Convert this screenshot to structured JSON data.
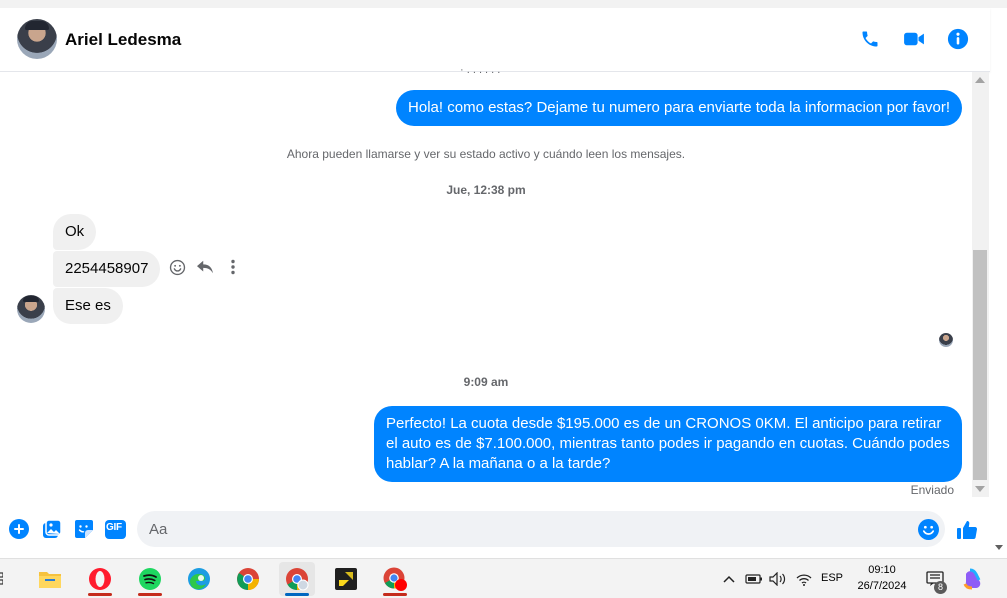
{
  "header": {
    "contact_name": "Ariel Ledesma",
    "icons": [
      "phone-icon",
      "video-call-icon",
      "info-icon"
    ]
  },
  "conversation": {
    "truncated_text": "· . . . . . .",
    "outgoing_1": "Hola! como estas? Dejame tu numero para enviarte toda la informacion por favor!",
    "system_notice": "Ahora pueden llamarse y ver su estado activo y cuándo leen los mensajes.",
    "timestamp_1": "Jue, 12:38 pm",
    "incoming_1": "Ok",
    "incoming_2": "2254458907",
    "incoming_3": "Ese es",
    "timestamp_2": "9:09 am",
    "outgoing_2": "Perfecto! La cuota desde $195.000 es de un CRONOS 0KM. El anticipo para retirar el auto es de $7.100.000, mientras tanto podes ir pagando en cuotas. Cuándo podes hablar? A la mañana o a la tarde?",
    "sent_status": "Enviado"
  },
  "composer": {
    "placeholder": "Aa",
    "gif_label": "GIF"
  },
  "taskbar": {
    "apps": [
      "file-explorer",
      "opera",
      "spotify",
      "edge",
      "chrome",
      "chrome-profile",
      "sticky-notes",
      "chrome-recording"
    ],
    "language": "ESP",
    "time": "09:10",
    "date": "26/7/2024",
    "notification_count": "8"
  },
  "colors": {
    "accent": "#0084ff",
    "incoming_bubble": "#f0f0f0",
    "text_secondary": "#65676b"
  }
}
